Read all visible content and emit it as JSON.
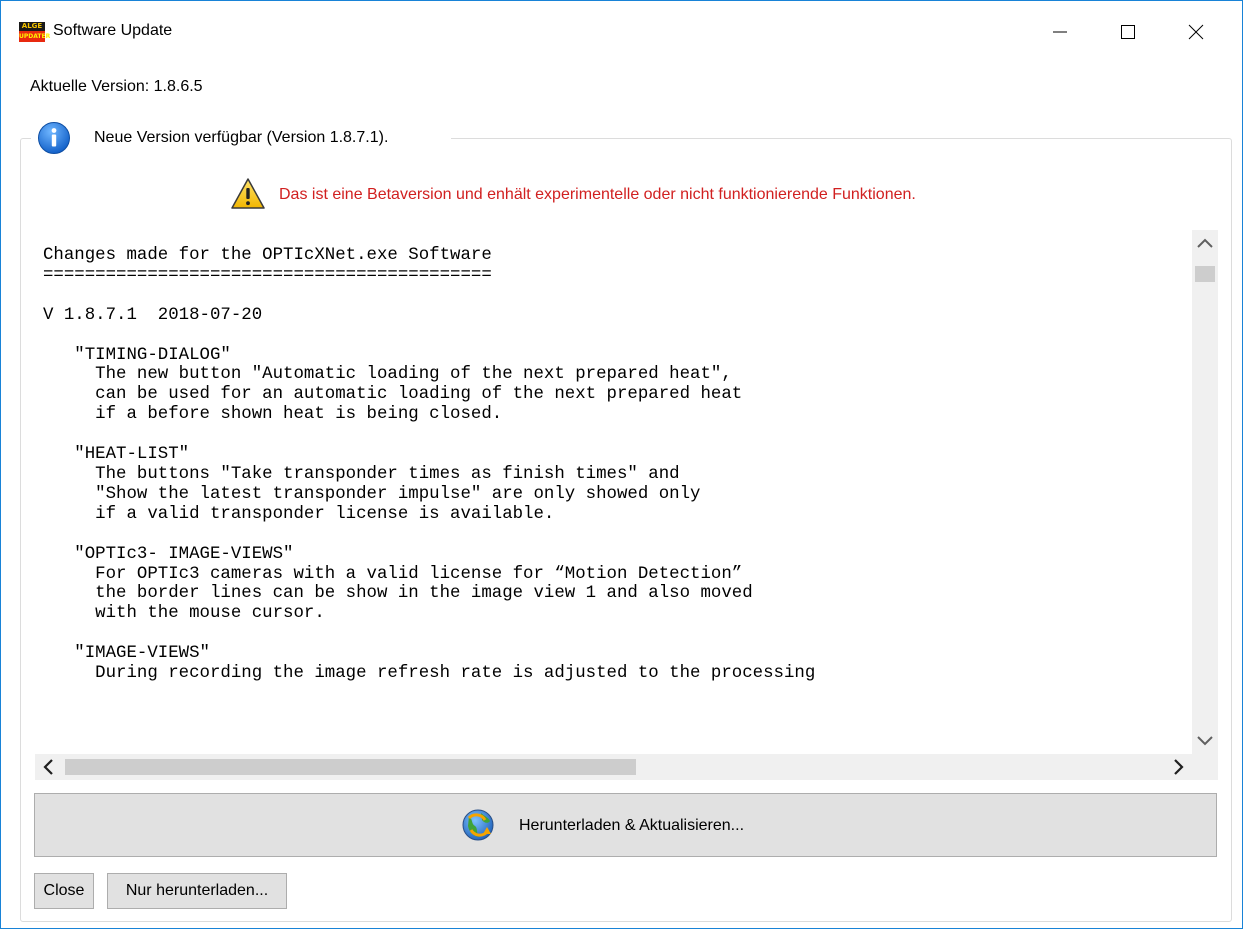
{
  "window": {
    "title": "Software Update",
    "app_icon": {
      "top_text": "ALGE",
      "bottom_text": "UPDATER"
    },
    "controls": [
      "minimize-icon",
      "maximize-icon",
      "close-icon"
    ]
  },
  "current_version_label": "Aktuelle Version: 1.8.6.5",
  "group": {
    "icon": "info-icon",
    "title": "Neue Version verfügbar (Version 1.8.7.1)."
  },
  "warning": {
    "icon": "warning-icon",
    "text": "Das ist eine Betaversion und enhält experimentelle oder nicht funktionierende Funktionen.",
    "color": "#d12020"
  },
  "changelog": {
    "text": "Changes made for the OPTIcXNet.exe Software\n===========================================\n\nV 1.8.7.1  2018-07-20\n\n   \"TIMING-DIALOG\"\n     The new button \"Automatic loading of the next prepared heat\",\n     can be used for an automatic loading of the next prepared heat\n     if a before shown heat is being closed.\n\n   \"HEAT-LIST\"\n     The buttons \"Take transponder times as finish times\" and\n     \"Show the latest transponder impulse\" are only showed only\n     if a valid transponder license is available.\n\n   \"OPTIc3- IMAGE-VIEWS\"\n     For OPTIc3 cameras with a valid license for “Motion Detection”\n     the border lines can be show in the image view 1 and also moved\n     with the mouse cursor.\n\n   \"IMAGE-VIEWS\"\n     During recording the image refresh rate is adjusted to the processing"
  },
  "buttons": {
    "download_update": "Herunterladen & Aktualisieren...",
    "close": "Close",
    "download_only": "Nur herunterladen..."
  }
}
